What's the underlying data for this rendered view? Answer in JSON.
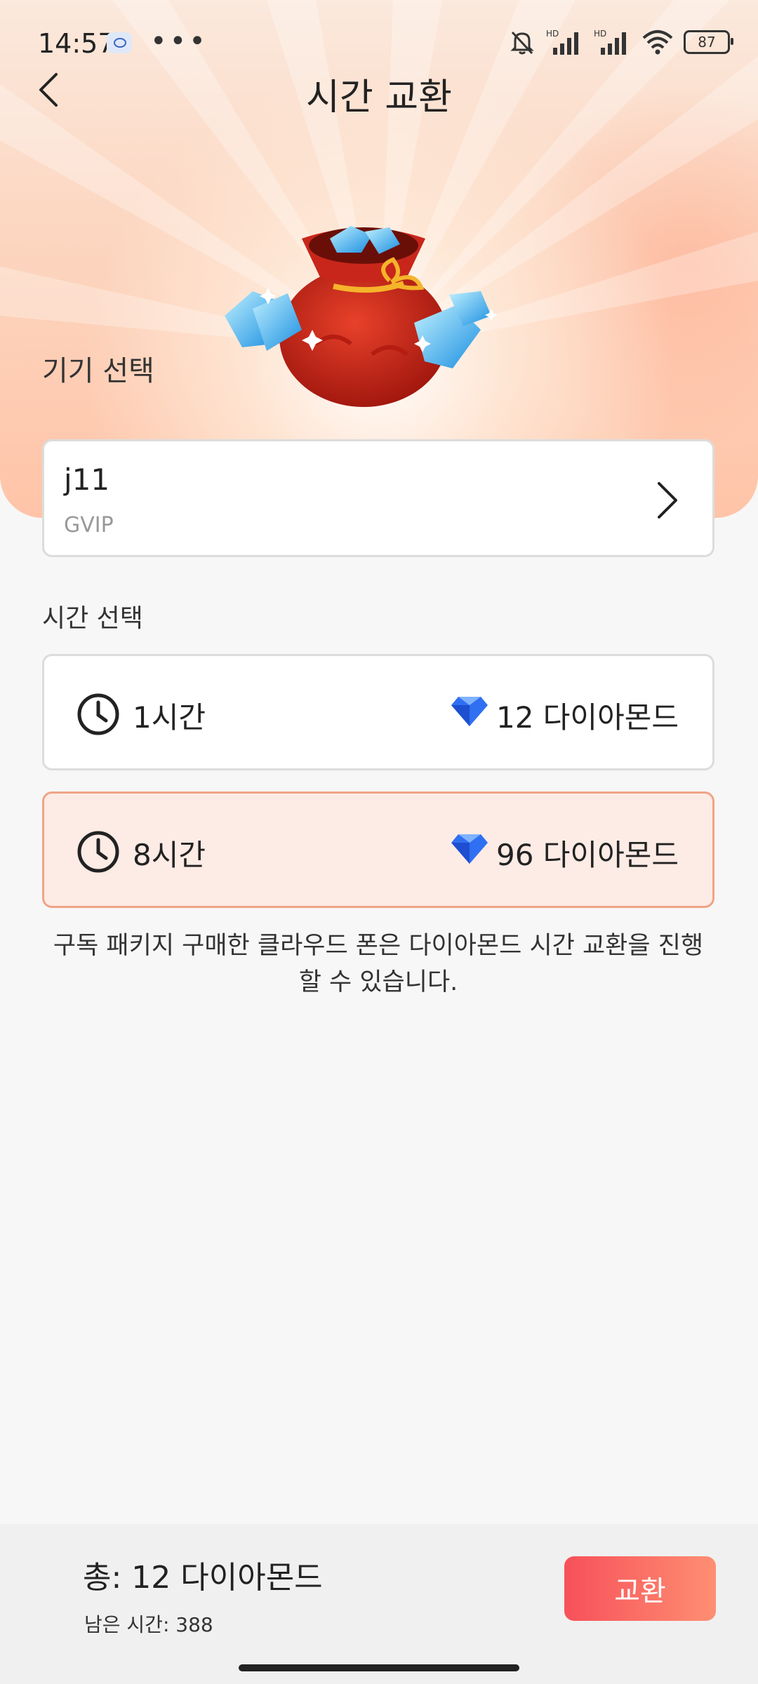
{
  "status_bar": {
    "time": "14:57",
    "more": "•••",
    "battery": "87"
  },
  "header": {
    "title": "시간 교환"
  },
  "device": {
    "section_label": "기기 선택",
    "name": "j11",
    "tier": "GVIP"
  },
  "time_select": {
    "section_label": "시간 선택",
    "options": [
      {
        "duration": "1시간",
        "price": "12 다이아몬드",
        "selected": false
      },
      {
        "duration": "8시간",
        "price": "96 다이아몬드",
        "selected": true
      }
    ]
  },
  "notice": "구독 패키지 구매한 클라우드 폰은 다이아몬드 시간 교환을 진행할 수 있습니다.",
  "footer": {
    "total": "총:  12 다이아몬드",
    "remaining": "남은 시간:  388",
    "exchange_button": "교환"
  },
  "colors": {
    "accent_start": "#f7505a",
    "accent_end": "#fe8f72",
    "selected_bg": "#fdebe5",
    "selected_border": "#f0a486"
  }
}
